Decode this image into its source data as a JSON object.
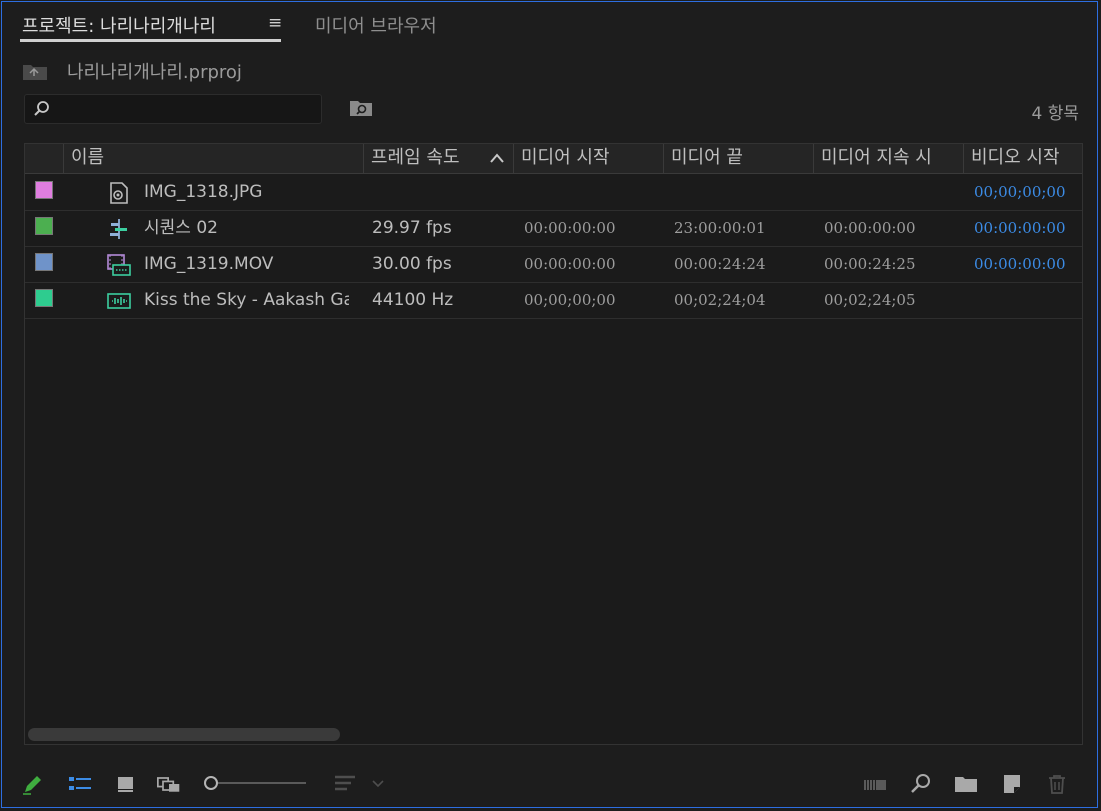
{
  "tabs": {
    "project_label": "프로젝트: 나리나리개나리",
    "menu_glyph": "≡",
    "media_browser_label": "미디어 브라우저"
  },
  "project": {
    "file_name": "나리나리개나리.prproj",
    "item_count": "4 항목"
  },
  "search": {
    "value": "",
    "placeholder": ""
  },
  "table": {
    "columns": [
      "이름",
      "프레임 속도",
      "미디어 시작",
      "미디어 끝",
      "미디어 지속 시",
      "비디오 시작"
    ],
    "sort_column": "프레임 속도",
    "rows": [
      {
        "label_color": "#e07ee0",
        "icon": "image-file-icon",
        "name": "IMG_1318.JPG",
        "fps": "",
        "media_start": "",
        "media_end": "",
        "media_duration": "",
        "video_start": "00;00;00;00"
      },
      {
        "label_color": "#4caf50",
        "icon": "sequence-icon",
        "name": "시퀀스 02",
        "fps": "29.97 fps",
        "media_start": "00:00:00:00",
        "media_end": "23:00:00:01",
        "media_duration": "00:00:00:00",
        "video_start": "00:00:00:00"
      },
      {
        "label_color": "#6f93c9",
        "icon": "video-file-icon",
        "name": "IMG_1319.MOV",
        "fps": "30.00 fps",
        "media_start": "00:00:00:00",
        "media_end": "00:00:24:24",
        "media_duration": "00:00:24:25",
        "video_start": "00:00:00:00"
      },
      {
        "label_color": "#2ecc8f",
        "icon": "audio-file-icon",
        "name": "Kiss the Sky - Aakash Ga",
        "fps": "44100 Hz",
        "media_start": "00;00;00;00",
        "media_end": "00;02;24;04",
        "media_duration": "00;02;24;05",
        "video_start": ""
      }
    ]
  },
  "toolbar": {
    "icons": [
      "pencil-icon",
      "list-view-icon",
      "icon-view-icon",
      "freeform-view-icon",
      "zoom-slider",
      "sort-icons-icon",
      "automate-to-sequence-icon",
      "find-icon",
      "new-bin-icon",
      "new-item-icon",
      "clear-icon"
    ]
  },
  "colors": {
    "accent": "#3c8ce6",
    "border": "#2d6ee0",
    "pencil": "#3fae3f"
  }
}
